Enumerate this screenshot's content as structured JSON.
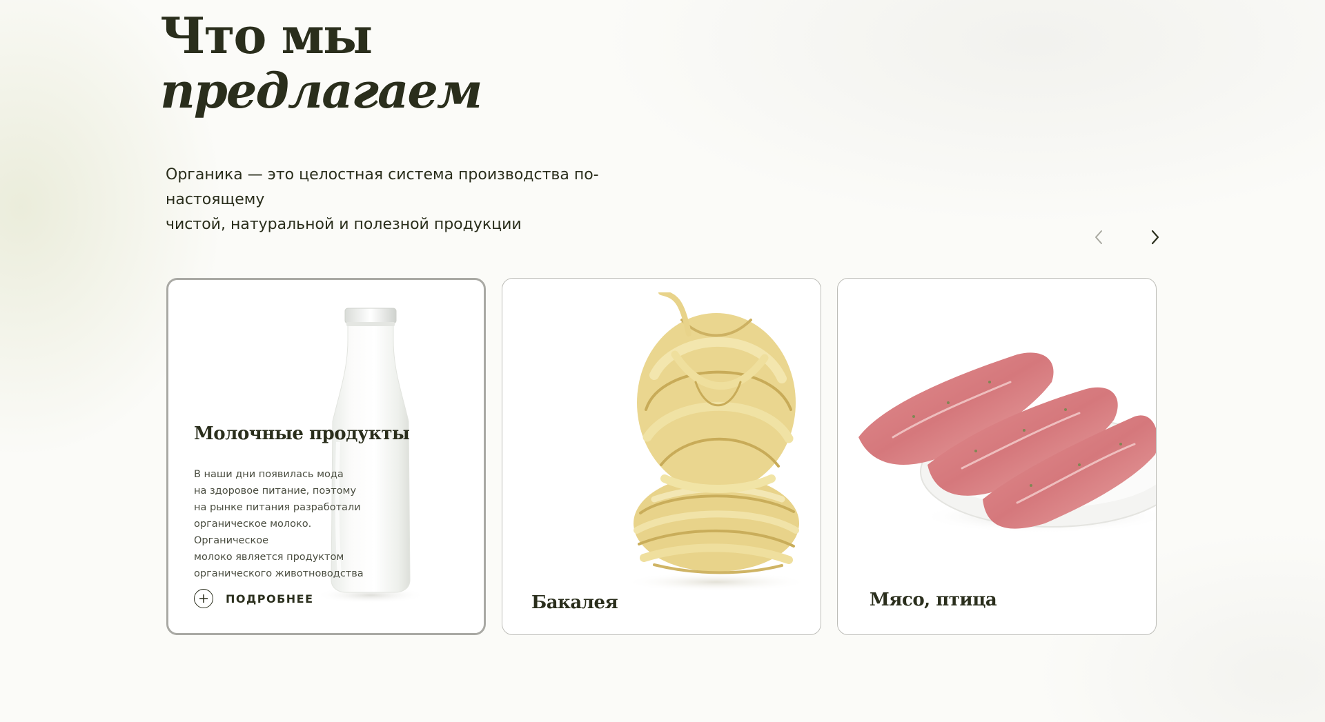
{
  "heading": {
    "line1": "Что мы",
    "line2": "предлагаем"
  },
  "lead": {
    "line1": "Органика — это целостная система производства по-настоящему",
    "line2": "чистой, натуральной и полезной продукции"
  },
  "carousel": {
    "prev_icon": "chevron-left-icon",
    "next_icon": "chevron-right-icon",
    "cards": [
      {
        "title": "Молочные продукты",
        "text_lines": [
          "В наши дни появилась мода",
          "на здоровое питание, поэтому",
          "на рынке питания разработали",
          "органическое молоко. Органическое",
          "молоко является продуктом",
          "органического животноводства"
        ],
        "more_label": "ПОДРОБНЕЕ",
        "more_icon": "plus-circle-icon",
        "image": "milk-bottle-image"
      },
      {
        "title": "Бакалея",
        "image": "pasta-nests-image"
      },
      {
        "title": "Мясо, птица",
        "image": "raw-meat-plate-image"
      }
    ]
  },
  "colors": {
    "text_dark": "#2a2e1c",
    "card_border": "#bdbdb8",
    "active_border": "#a9a9a4",
    "background": "#fbfbf8"
  }
}
